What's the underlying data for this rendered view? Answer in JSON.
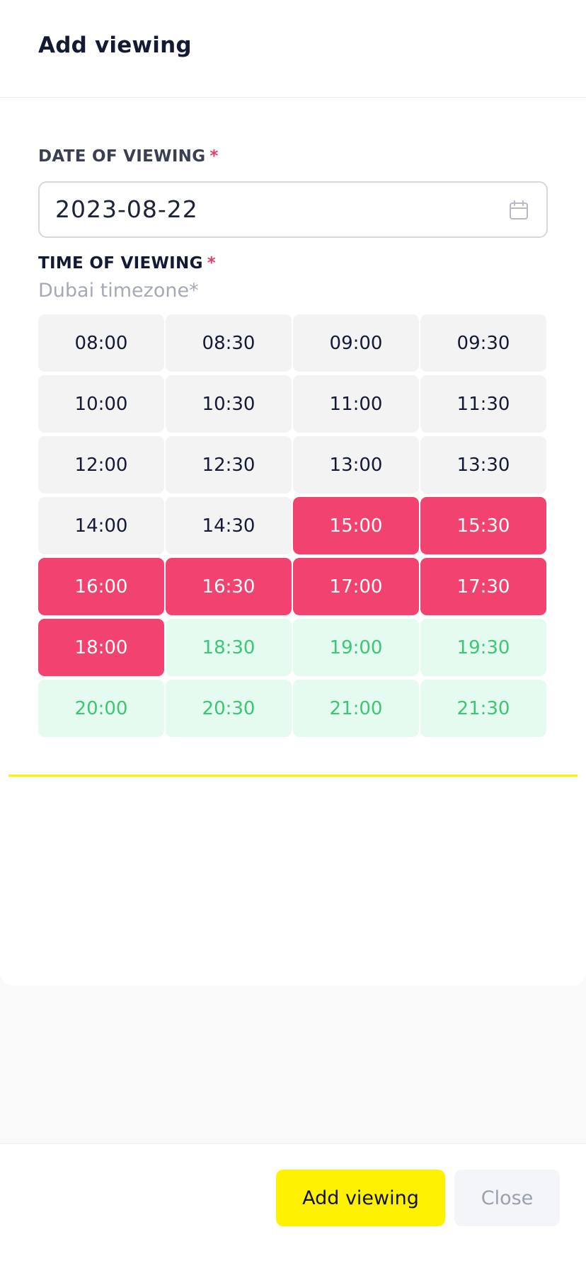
{
  "modal": {
    "title": "Add viewing"
  },
  "date_field": {
    "label": "DATE OF VIEWING",
    "required_marker": "*",
    "value": "2023-08-22",
    "icon": "calendar-icon"
  },
  "time_field": {
    "label": "TIME OF VIEWING",
    "required_marker": "*",
    "timezone_note": "Dubai timezone*"
  },
  "time_slots": [
    {
      "time": "08:00",
      "status": "free"
    },
    {
      "time": "08:30",
      "status": "free"
    },
    {
      "time": "09:00",
      "status": "free"
    },
    {
      "time": "09:30",
      "status": "free"
    },
    {
      "time": "10:00",
      "status": "free"
    },
    {
      "time": "10:30",
      "status": "free"
    },
    {
      "time": "11:00",
      "status": "free"
    },
    {
      "time": "11:30",
      "status": "free"
    },
    {
      "time": "12:00",
      "status": "free"
    },
    {
      "time": "12:30",
      "status": "free"
    },
    {
      "time": "13:00",
      "status": "free"
    },
    {
      "time": "13:30",
      "status": "free"
    },
    {
      "time": "14:00",
      "status": "free"
    },
    {
      "time": "14:30",
      "status": "free"
    },
    {
      "time": "15:00",
      "status": "booked"
    },
    {
      "time": "15:30",
      "status": "booked"
    },
    {
      "time": "16:00",
      "status": "booked"
    },
    {
      "time": "16:30",
      "status": "booked"
    },
    {
      "time": "17:00",
      "status": "booked"
    },
    {
      "time": "17:30",
      "status": "booked"
    },
    {
      "time": "18:00",
      "status": "booked"
    },
    {
      "time": "18:30",
      "status": "available"
    },
    {
      "time": "19:00",
      "status": "available"
    },
    {
      "time": "19:30",
      "status": "available"
    },
    {
      "time": "20:00",
      "status": "available"
    },
    {
      "time": "20:30",
      "status": "available"
    },
    {
      "time": "21:00",
      "status": "available"
    },
    {
      "time": "21:30",
      "status": "available"
    }
  ],
  "footer": {
    "primary_label": "Add viewing",
    "secondary_label": "Close"
  },
  "colors": {
    "accent": "#fff200",
    "booked": "#f24370",
    "available_bg": "#e6fbef",
    "available_text": "#3cc679",
    "required": "#e83d6c"
  }
}
